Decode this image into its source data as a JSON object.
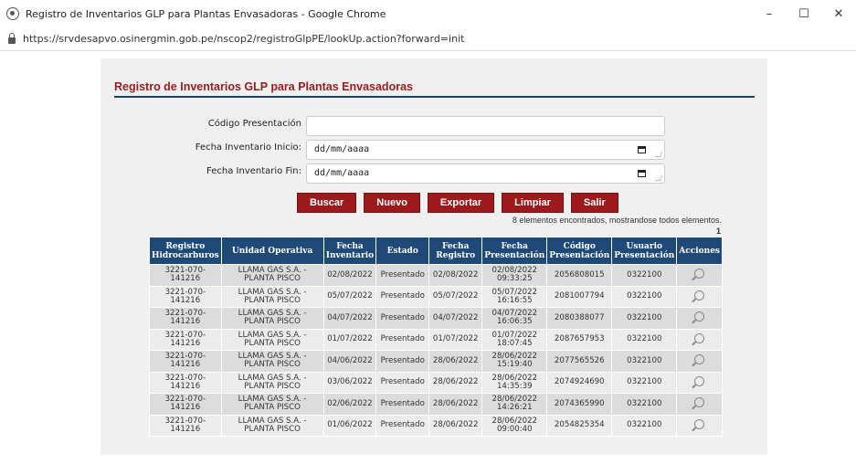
{
  "window": {
    "title": "Registro de Inventarios GLP para Plantas Envasadoras - Google Chrome",
    "url": "https://srvdesapvo.osinergmin.gob.pe/nscop2/registroGlpPE/lookUp.action?forward=init"
  },
  "page_title": "Registro de Inventarios GLP para Plantas Envasadoras",
  "form": {
    "codigo_label": "Código Presentación",
    "codigo_value": "",
    "fecha_inicio_label": "Fecha Inventario Inicio:",
    "fecha_inicio_value": "dd/mm/aaaa",
    "fecha_fin_label": "Fecha Inventario Fin:",
    "fecha_fin_value": "dd/mm/aaaa"
  },
  "buttons": {
    "buscar": "Buscar",
    "nuevo": "Nuevo",
    "exportar": "Exportar",
    "limpiar": "Limpiar",
    "salir": "Salir"
  },
  "result_count": "8 elementos encontrados, mostrandose todos elementos.",
  "page_number": "1",
  "table": {
    "headers": [
      "Registro Hidrocarburos",
      "Unidad Operativa",
      "Fecha Inventario",
      "Estado",
      "Fecha Registro",
      "Fecha Presentación",
      "Código Presentación",
      "Usuario Presentación",
      "Acciones"
    ],
    "rows": [
      [
        "3221-070-141216",
        "LLAMA GAS S.A. - PLANTA PISCO",
        "02/08/2022",
        "Presentado",
        "02/08/2022",
        "02/08/2022 09:33:25",
        "2056808015",
        "0322100"
      ],
      [
        "3221-070-141216",
        "LLAMA GAS S.A. - PLANTA PISCO",
        "05/07/2022",
        "Presentado",
        "05/07/2022",
        "05/07/2022 16:16:55",
        "2081007794",
        "0322100"
      ],
      [
        "3221-070-141216",
        "LLAMA GAS S.A. - PLANTA PISCO",
        "04/07/2022",
        "Presentado",
        "04/07/2022",
        "04/07/2022 16:06:35",
        "2080388077",
        "0322100"
      ],
      [
        "3221-070-141216",
        "LLAMA GAS S.A. - PLANTA PISCO",
        "01/07/2022",
        "Presentado",
        "01/07/2022",
        "01/07/2022 18:07:45",
        "2087657953",
        "0322100"
      ],
      [
        "3221-070-141216",
        "LLAMA GAS S.A. - PLANTA PISCO",
        "04/06/2022",
        "Presentado",
        "28/06/2022",
        "28/06/2022 15:19:40",
        "2077565526",
        "0322100"
      ],
      [
        "3221-070-141216",
        "LLAMA GAS S.A. - PLANTA PISCO",
        "03/06/2022",
        "Presentado",
        "28/06/2022",
        "28/06/2022 14:35:39",
        "2074924690",
        "0322100"
      ],
      [
        "3221-070-141216",
        "LLAMA GAS S.A. - PLANTA PISCO",
        "02/06/2022",
        "Presentado",
        "28/06/2022",
        "28/06/2022 14:26:21",
        "2074365990",
        "0322100"
      ],
      [
        "3221-070-141216",
        "LLAMA GAS S.A. - PLANTA PISCO",
        "01/06/2022",
        "Presentado",
        "28/06/2022",
        "28/06/2022 09:00:40",
        "2054825354",
        "0322100"
      ]
    ]
  },
  "colors": {
    "accent": "#9c1a1c",
    "header_bg": "#1f4a78",
    "rule": "#1f3f6f"
  },
  "icons": {
    "row_action": "zoom-icon",
    "input_calendar": "calendar-icon"
  }
}
